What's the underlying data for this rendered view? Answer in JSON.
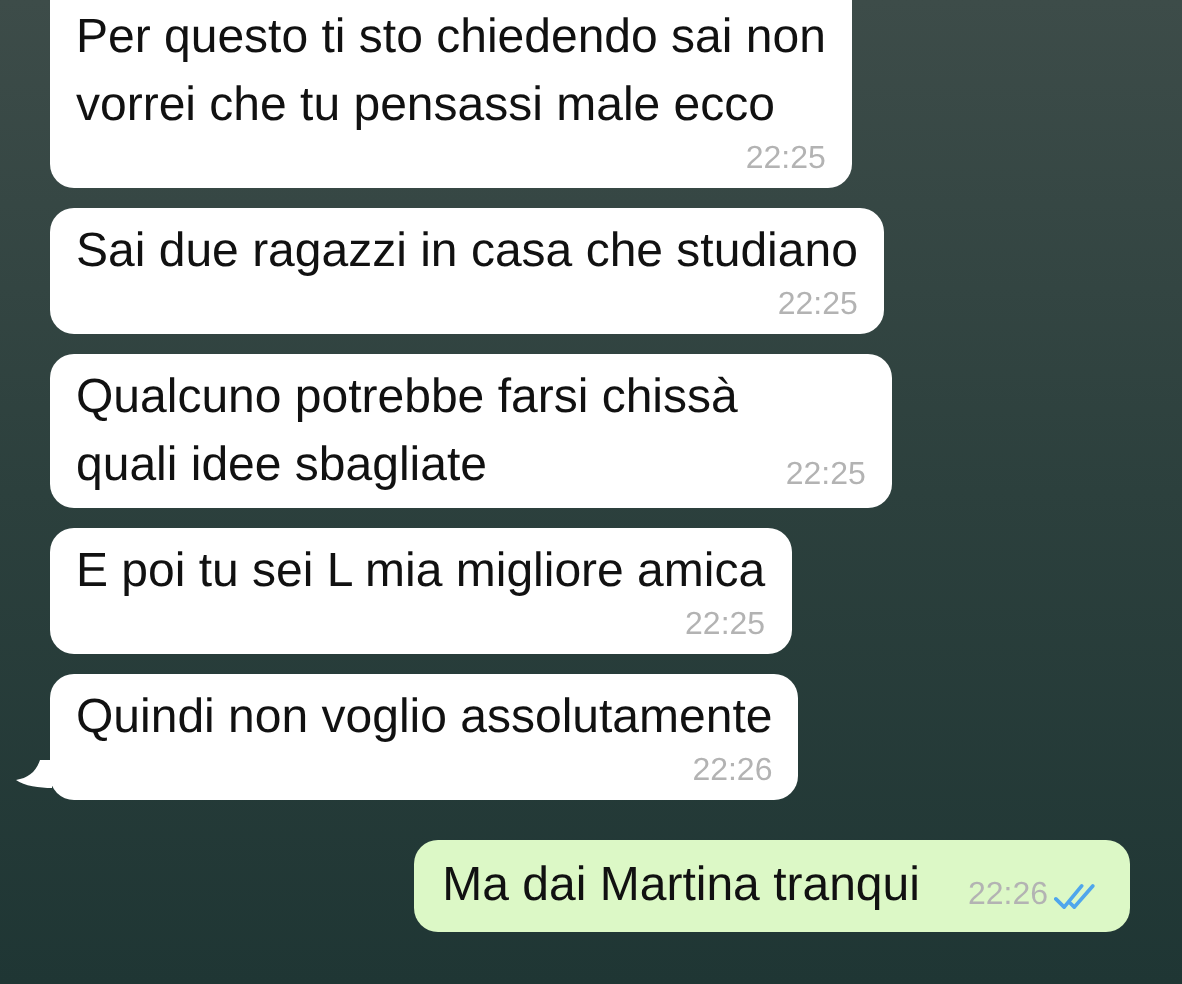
{
  "messages": [
    {
      "kind": "incoming",
      "text": "Per questo ti sto chiedendo sai non\nvorrei che tu pensassi male ecco",
      "time": "22:25",
      "time_inline": false,
      "tail": false
    },
    {
      "kind": "incoming",
      "text": "Sai due ragazzi in casa che studiano",
      "time": "22:25",
      "time_inline": false,
      "tail": false
    },
    {
      "kind": "incoming",
      "text": "Qualcuno potrebbe farsi chissà\nquali idee sbagliate",
      "time": "22:25",
      "time_inline": true,
      "tail": false
    },
    {
      "kind": "incoming",
      "text": "E poi tu sei L mia migliore amica",
      "time": "22:25",
      "time_inline": false,
      "tail": false
    },
    {
      "kind": "incoming",
      "text": "Quindi non voglio assolutamente",
      "time": "22:26",
      "time_inline": false,
      "tail": true
    },
    {
      "kind": "outgoing",
      "text": "Ma dai Martina tranqui",
      "time": "22:26",
      "time_inline": true,
      "tail": false,
      "read": true
    }
  ]
}
